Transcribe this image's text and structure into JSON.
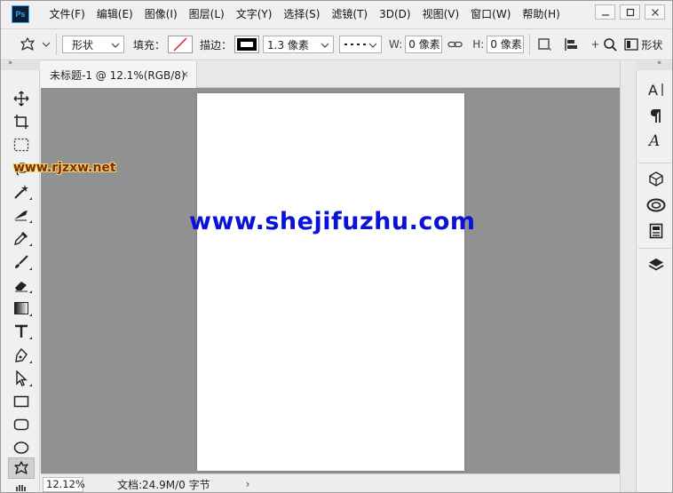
{
  "app": {
    "logo_text": "Ps",
    "menu": [
      "文件(F)",
      "编辑(E)",
      "图像(I)",
      "图层(L)",
      "文字(Y)",
      "选择(S)",
      "滤镜(T)",
      "3D(D)",
      "视图(V)",
      "窗口(W)",
      "帮助(H)"
    ]
  },
  "options": {
    "mode_value": "形状",
    "fill_label": "填充：",
    "stroke_label": "描边：",
    "stroke_width_value": "1.3 像素",
    "w_label": "W:",
    "w_value": "0 像素",
    "h_label": "H:",
    "h_value": "0 像素",
    "shape_label": "形状"
  },
  "document": {
    "tab_title": "未标题-1 @ 12.1%(RGB/8)",
    "close_symbol": "×"
  },
  "status": {
    "zoom_value": "12.12%",
    "doc_info": "文档:24.9M/0 字节",
    "arrow": "›"
  },
  "watermarks": {
    "small": "www.rjzxw.net",
    "large": "www.shejifuzhu.com"
  },
  "colors": {
    "canvas_bg": "#919191",
    "page_bg": "#ffffff",
    "watermark_blue": "#0a12d8",
    "watermark_brown": "#7b2e08",
    "ps_blue": "#31a8ff"
  }
}
